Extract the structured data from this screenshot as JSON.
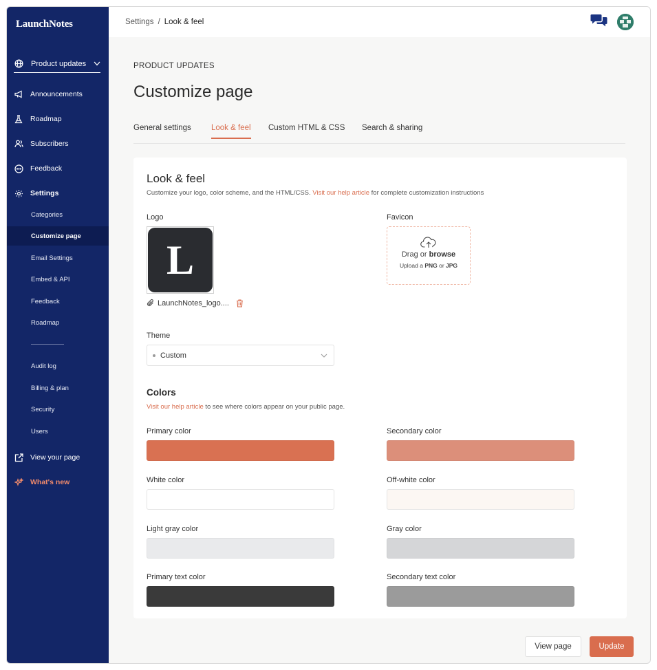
{
  "brand": "LaunchNotes",
  "workspace": {
    "label": "Product updates"
  },
  "nav": {
    "announcements": "Announcements",
    "roadmap": "Roadmap",
    "subscribers": "Subscribers",
    "feedback": "Feedback",
    "settings": "Settings",
    "sub": [
      "Categories",
      "Customize page",
      "Email Settings",
      "Embed & API",
      "Feedback",
      "Roadmap"
    ],
    "sub2": [
      "Audit log",
      "Billing & plan",
      "Security",
      "Users"
    ],
    "view_page": "View your page",
    "whats_new": "What's new"
  },
  "breadcrumb": {
    "parent": "Settings",
    "separator": "/",
    "current": "Look & feel"
  },
  "main": {
    "eyebrow": "PRODUCT UPDATES",
    "title": "Customize page",
    "tabs": [
      "General settings",
      "Look & feel",
      "Custom HTML & CSS",
      "Search & sharing"
    ],
    "active_tab": "Look & feel"
  },
  "card": {
    "title": "Look & feel",
    "desc_before": "Customize your logo, color scheme, and the HTML/CSS. ",
    "desc_link": "Visit our help article",
    "desc_after": " for complete customization instructions",
    "logo_label": "Logo",
    "logo_letter": "L",
    "logo_filename": "LaunchNotes_logo....",
    "favicon_label": "Favicon",
    "favicon": {
      "drag": "Drag or ",
      "browse": "browse",
      "hint_1": "Upload a ",
      "png": "PNG",
      "hint_or": " or ",
      "jpg": "JPG"
    },
    "theme_label": "Theme",
    "theme_value": "Custom",
    "colors_title": "Colors",
    "colors_link": "Visit our help article",
    "colors_desc": " to see where colors appear on your public page."
  },
  "colors": [
    {
      "label": "Primary color",
      "value": "#d97152"
    },
    {
      "label": "Secondary color",
      "value": "#dc8f7a"
    },
    {
      "label": "White color",
      "value": "#ffffff"
    },
    {
      "label": "Off-white color",
      "value": "#fcf7f3"
    },
    {
      "label": "Light gray color",
      "value": "#e9eaec"
    },
    {
      "label": "Gray color",
      "value": "#d5d6d8"
    },
    {
      "label": "Primary text color",
      "value": "#3a3a3a"
    },
    {
      "label": "Secondary text color",
      "value": "#9b9b9b"
    }
  ],
  "buttons": {
    "view_page": "View page",
    "update": "Update"
  },
  "accent_color": "#d96d4e",
  "sidebar_color": "#132667"
}
